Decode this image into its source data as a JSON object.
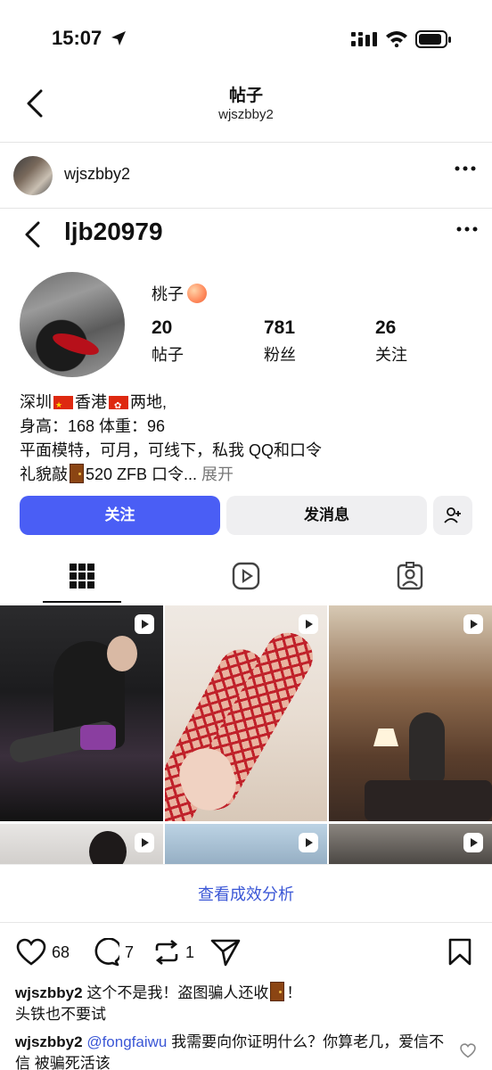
{
  "status_bar": {
    "time": "15:07"
  },
  "header": {
    "title": "帖子",
    "subtitle": "wjszbby2"
  },
  "author": {
    "username": "wjszbby2"
  },
  "profile": {
    "handle": "ljb20979",
    "nickname": "桃子",
    "stats": [
      {
        "value": "20",
        "label": "帖子"
      },
      {
        "value": "781",
        "label": "粉丝"
      },
      {
        "value": "26",
        "label": "关注"
      }
    ],
    "bio": {
      "line1_a": "深圳",
      "line1_b": "香港",
      "line1_c": "两地,",
      "line2": "身高：168 体重：96",
      "line3": "平面模特，可月，可线下，私我 QQ和口令",
      "line4_a": "礼貌敲",
      "line4_b": "520 ZFB 口令...",
      "expand": " 展开"
    },
    "buttons": {
      "follow": "关注",
      "message": "发消息"
    }
  },
  "insights_link": "查看成效分析",
  "actions": {
    "likes": "68",
    "comments": "7",
    "reposts": "1"
  },
  "comments": [
    {
      "user": "wjszbby2",
      "text_a": " 这个不是我！盗图骗人还收",
      "text_b": "！",
      "text_c": "头铁也不要试"
    },
    {
      "user": "wjszbby2",
      "mention": "@fongfaiwu",
      "text": " 我需要向你证明什么？你算老几，爱信不信 被骗死活该"
    }
  ],
  "colors": {
    "accent": "#4a5ef5",
    "link": "#3b57d6"
  }
}
